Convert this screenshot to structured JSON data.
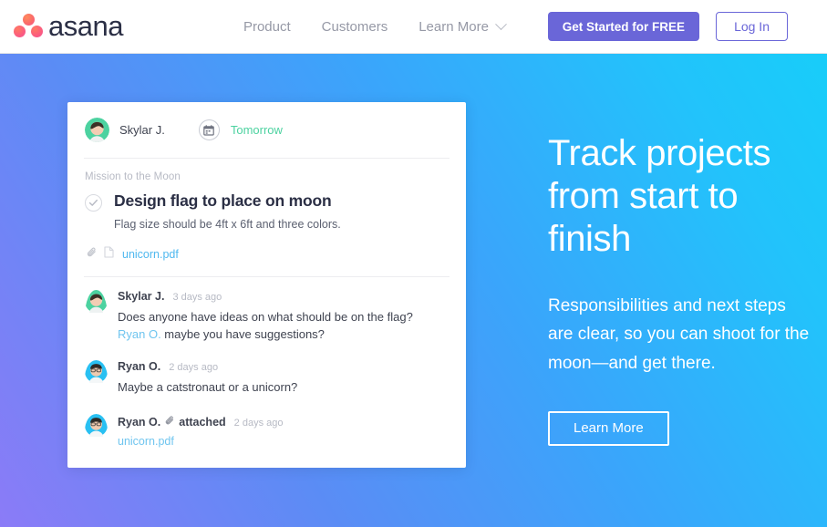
{
  "header": {
    "logo_text": "asana",
    "logo_icon": "asana-three-dots-logo",
    "nav": [
      {
        "label": "Product",
        "icon": null
      },
      {
        "label": "Customers",
        "icon": null
      },
      {
        "label": "Learn More",
        "icon": "chevron-down-icon"
      }
    ],
    "cta_primary": "Get Started for FREE",
    "cta_secondary": "Log In",
    "colors": {
      "primary": "#6a66d8",
      "nav_text": "#9699a6"
    }
  },
  "hero": {
    "heading": "Track projects from start to finish",
    "paragraph": "Responsibilities and next steps are clear, so you can shoot for the moon—and get there.",
    "button": "Learn More",
    "gradient_from": "#8b7bf7",
    "gradient_to": "#18cdf9"
  },
  "card": {
    "assignee": {
      "name": "Skylar J.",
      "avatar_icon": "avatar-skylar",
      "due_icon": "calendar-icon",
      "due_label": "Tomorrow",
      "due_color": "#4cd2a0"
    },
    "task": {
      "project": "Mission to the Moon",
      "check_icon": "check-circle-icon",
      "title": "Design flag to place on moon",
      "description": "Flag size should be 4ft x 6ft and three colors."
    },
    "attachment": {
      "clip_icon": "paperclip-icon",
      "file_icon": "file-icon",
      "filename": "unicorn.pdf",
      "link_color": "#4fb8ef"
    },
    "comments": [
      {
        "avatar_icon": "avatar-skylar",
        "author": "Skylar J.",
        "time": "3 days ago",
        "text_before": "Does anyone have ideas on what should be on the flag? ",
        "mention": "Ryan O.",
        "text_after": " maybe you have suggestions?"
      },
      {
        "avatar_icon": "avatar-ryan",
        "author": "Ryan O.",
        "time": "2 days ago",
        "text_before": "Maybe a catstronaut or a unicorn?",
        "mention": null,
        "text_after": null
      }
    ],
    "attachment_event": {
      "avatar_icon": "avatar-ryan",
      "author": "Ryan O.",
      "clip_icon": "paperclip-icon",
      "action": "attached",
      "time": "2 days ago",
      "filename": "unicorn.pdf"
    }
  }
}
